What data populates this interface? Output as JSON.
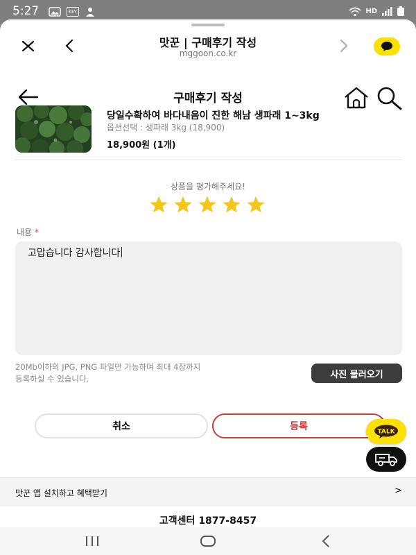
{
  "status_bar": {
    "time": "5:27",
    "icons": [
      "image-icon",
      "key-icon",
      "user-icon"
    ],
    "right_text": "HD"
  },
  "browser": {
    "title": "맛꾼 | 구매후기 작성",
    "url": "mggoon.co.kr"
  },
  "page": {
    "title": "구매후기 작성"
  },
  "product": {
    "name": "당일수확하여 바다내음이 진한 해남 생파래 1~3kg",
    "option": "옵션선택 : 생파래 3kg (18,900)",
    "price": "18,900원 (1개)"
  },
  "rating": {
    "prompt": "상품을 평가해주세요!",
    "value": 5,
    "max": 5,
    "star_color": "#f5c518"
  },
  "review": {
    "label": "내용",
    "required_mark": "*",
    "text": "고맙습니다 감사합니다"
  },
  "upload": {
    "note_line1": "20Mb이하의 JPG, PNG 파일만 가능하며 최대 4장까지",
    "note_line2": "등록하실 수 있습니다.",
    "button": "사진 불러오기"
  },
  "actions": {
    "cancel": "취소",
    "submit": "등록",
    "submit_color": "#d23a3a"
  },
  "fabs": {
    "talk": "TALK"
  },
  "footer": {
    "app_banner": "맛꾼 앱 설치하고 혜택받기",
    "app_banner_arrow": ">",
    "customer_center": "고객센터 1877-8457"
  }
}
